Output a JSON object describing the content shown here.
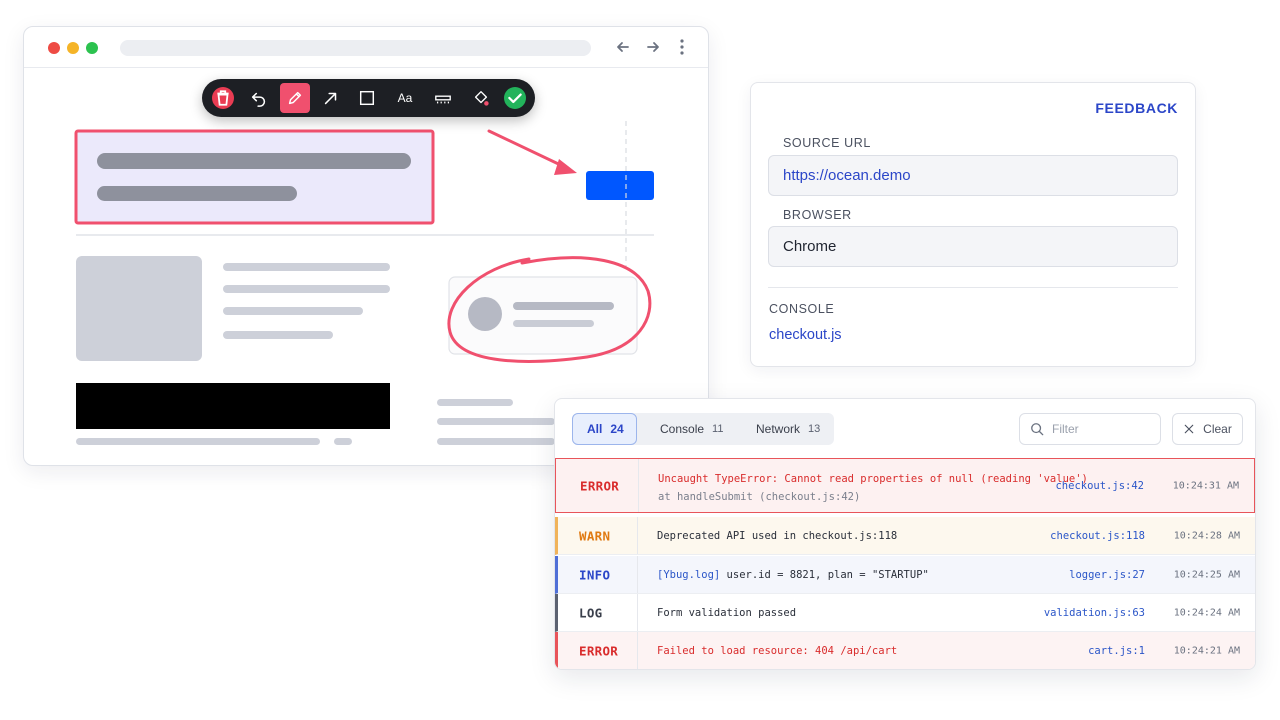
{
  "colors": {
    "accent": "#2b46c8",
    "annotation": "#f0506e",
    "error": "#d92c2c",
    "warn": "#e07a12",
    "info": "#2b46c8",
    "traffic_red": "#ee4b44",
    "traffic_yellow": "#f5b428",
    "traffic_green": "#2cc24f"
  },
  "toolbar": {
    "tools": [
      "trash-icon",
      "undo-icon",
      "pen-icon",
      "arrow-icon",
      "rectangle-icon",
      "text-icon",
      "blur-icon",
      "fill-icon",
      "check-icon"
    ],
    "text_tool_label": "Aa"
  },
  "feedback": {
    "title": "FEEDBACK",
    "source_url_label": "SOURCE URL",
    "source_url_value": "https://ocean.demo",
    "browser_label": "BROWSER",
    "browser_value": "Chrome",
    "console_label": "CONSOLE",
    "console_link": "checkout.js"
  },
  "console": {
    "tabs": [
      {
        "label": "All",
        "count": "24"
      },
      {
        "label": "Console",
        "count": "11"
      },
      {
        "label": "Network",
        "count": "13"
      }
    ],
    "filter_placeholder": "Filter",
    "clear_label": "Clear",
    "logs": [
      {
        "level": "ERROR",
        "message": "Uncaught TypeError: Cannot read properties of null (reading 'value')",
        "detail": "at handleSubmit (checkout.js:42)",
        "source": "checkout.js:42",
        "time": "10:24:31 AM"
      },
      {
        "level": "WARN",
        "message": "Deprecated API used in checkout.js:118",
        "source": "checkout.js:118",
        "time": "10:24:28 AM"
      },
      {
        "level": "INFO",
        "prefix": "[Ybug.log]",
        "message": "user.id = 8821, plan = \"STARTUP\"",
        "source": "logger.js:27",
        "time": "10:24:25 AM"
      },
      {
        "level": "LOG",
        "message": "Form validation passed",
        "source": "validation.js:63",
        "time": "10:24:24 AM"
      },
      {
        "level": "ERROR",
        "message": "Failed to load resource: 404 /api/cart",
        "source": "cart.js:1",
        "time": "10:24:21 AM"
      }
    ]
  }
}
